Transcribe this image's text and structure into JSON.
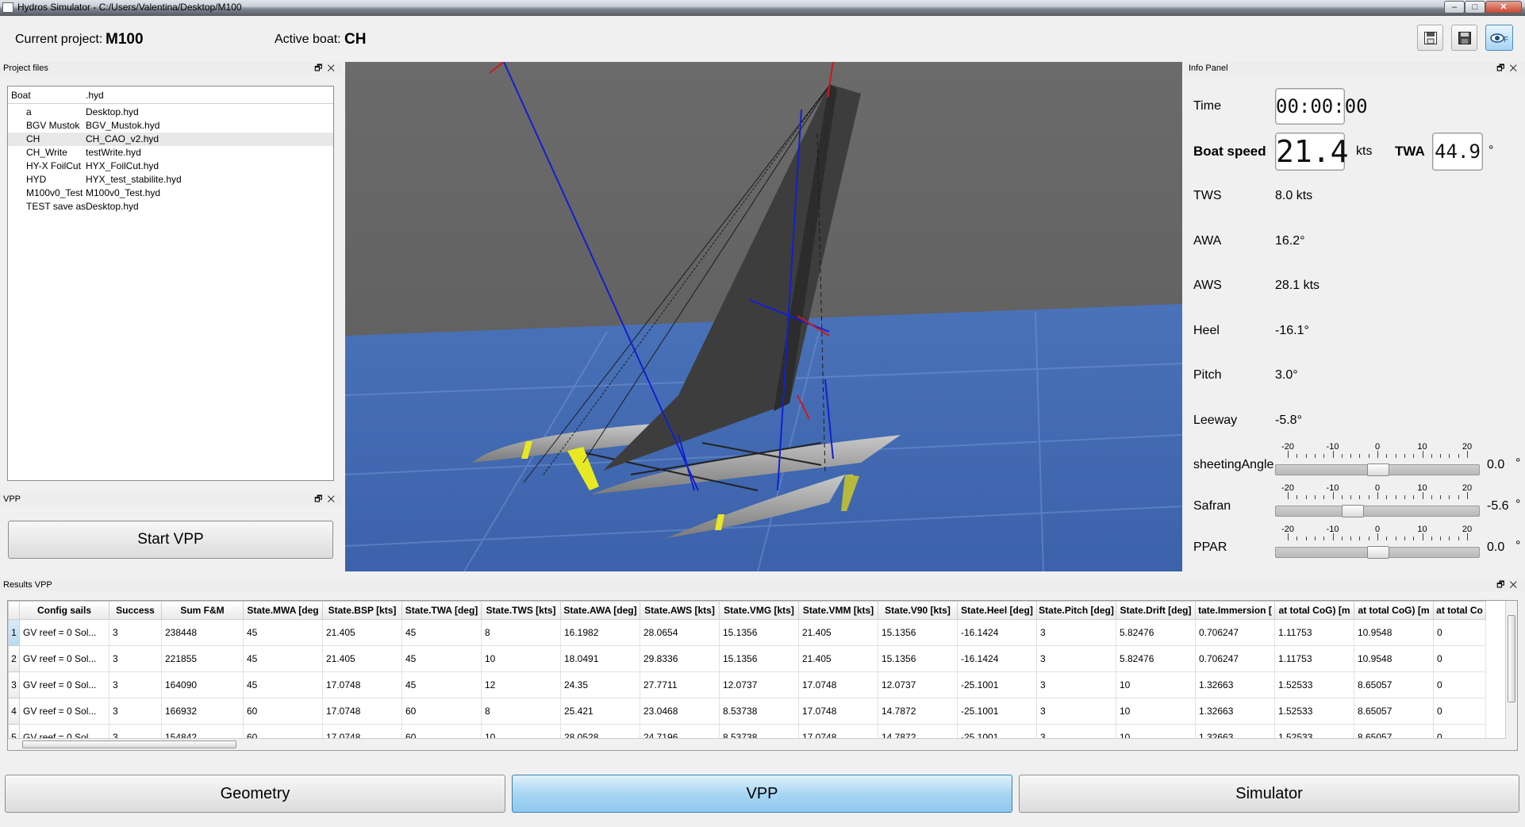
{
  "window": {
    "title": "Hydros Simulator - C:/Users/Valentina/Desktop/M100",
    "min": "–",
    "max": "□",
    "close": "✕"
  },
  "header": {
    "project_label": "Current project:",
    "project_value": "M100",
    "boat_label": "Active boat:",
    "boat_value": "CH"
  },
  "toolbar": {
    "icons": [
      "save-icon",
      "save-as-icon",
      "eye-icon"
    ]
  },
  "project_files": {
    "title": "Project files",
    "columns": [
      "Boat",
      ".hyd"
    ],
    "rows": [
      [
        "a",
        "Desktop.hyd"
      ],
      [
        "BGV Mustok",
        "BGV_Mustok.hyd"
      ],
      [
        "CH",
        "CH_CAO_v2.hyd"
      ],
      [
        "CH_Write",
        "testWrite.hyd"
      ],
      [
        "HY-X FoilCut",
        "HYX_FoilCut.hyd"
      ],
      [
        "HYD",
        "HYX_test_stabilite.hyd"
      ],
      [
        "M100v0_Test",
        "M100v0_Test.hyd"
      ],
      [
        "TEST save as",
        "Desktop.hyd"
      ]
    ],
    "selected_index": 2
  },
  "vpp_panel": {
    "title": "VPP",
    "start_button": "Start VPP"
  },
  "info_panel": {
    "title": "Info Panel",
    "time_label": "Time",
    "time_value": "00:00:00",
    "boat_speed_label": "Boat speed",
    "boat_speed_value": "21.4",
    "boat_speed_unit": "kts",
    "twa_label": "TWA",
    "twa_value": "44.9",
    "twa_unit": "°",
    "rows": [
      {
        "label": "TWS",
        "value": "8.0 kts"
      },
      {
        "label": "AWA",
        "value": "16.2°"
      },
      {
        "label": "AWS",
        "value": "28.1 kts"
      },
      {
        "label": "Heel",
        "value": "-16.1°"
      },
      {
        "label": "Pitch",
        "value": "3.0°"
      },
      {
        "label": "Leeway",
        "value": "-5.8°"
      }
    ],
    "sliders": [
      {
        "label": "sheetingAngle",
        "value": 0.0,
        "display": "0.0",
        "unit": "°"
      },
      {
        "label": "Safran",
        "value": -5.6,
        "display": "-5.6",
        "unit": "°"
      },
      {
        "label": "PPAR",
        "value": 0.0,
        "display": "0.0",
        "unit": "°"
      }
    ],
    "scale_labels": [
      "-20",
      "-10",
      "0",
      "10",
      "20"
    ],
    "scale_min": -20,
    "scale_max": 20
  },
  "results": {
    "title": "Results VPP",
    "columns": [
      "Config sails",
      "Success",
      "Sum F&M",
      "State.MWA [deg",
      "State.BSP [kts]",
      "State.TWA [deg]",
      "State.TWS [kts]",
      "State.AWA [deg]",
      "State.AWS [kts]",
      "State.VMG [kts]",
      "State.VMM [kts]",
      "State.V90 [kts]",
      "State.Heel [deg]",
      "State.Pitch [deg]",
      "State.Drift [deg]",
      "tate.Immersion [",
      "at total CoG) [m",
      "at total CoG) [m",
      "at total Co"
    ],
    "rows": [
      [
        "1",
        "GV reef = 0  Sol...",
        "3",
        "238448",
        "45",
        "21.405",
        "45",
        "8",
        "16.1982",
        "28.0654",
        "15.1356",
        "21.405",
        "15.1356",
        "-16.1424",
        "3",
        "5.82476",
        "0.706247",
        "1.11753",
        "10.9548",
        "0"
      ],
      [
        "2",
        "GV reef = 0  Sol...",
        "3",
        "221855",
        "45",
        "21.405",
        "45",
        "10",
        "18.0491",
        "29.8336",
        "15.1356",
        "21.405",
        "15.1356",
        "-16.1424",
        "3",
        "5.82476",
        "0.706247",
        "1.11753",
        "10.9548",
        "0"
      ],
      [
        "3",
        "GV reef = 0  Sol...",
        "3",
        "164090",
        "45",
        "17.0748",
        "45",
        "12",
        "24.35",
        "27.7711",
        "12.0737",
        "17.0748",
        "12.0737",
        "-25.1001",
        "3",
        "10",
        "1.32663",
        "1.52533",
        "8.65057",
        "0"
      ],
      [
        "4",
        "GV reef = 0  Sol...",
        "3",
        "166932",
        "60",
        "17.0748",
        "60",
        "8",
        "25.421",
        "23.0468",
        "8.53738",
        "17.0748",
        "14.7872",
        "-25.1001",
        "3",
        "10",
        "1.32663",
        "1.52533",
        "8.65057",
        "0"
      ],
      [
        "5",
        "GV reef = 0  Sol...",
        "3",
        "154842",
        "60",
        "17.0748",
        "60",
        "10",
        "28.0528",
        "24.7196",
        "8.53738",
        "17.0748",
        "14.7872",
        "-25.1001",
        "3",
        "10",
        "1.32663",
        "1.52533",
        "8.65057",
        "0"
      ]
    ]
  },
  "bottom_tabs": {
    "geometry": "Geometry",
    "vpp": "VPP",
    "simulator": "Simulator",
    "active": "VPP"
  }
}
